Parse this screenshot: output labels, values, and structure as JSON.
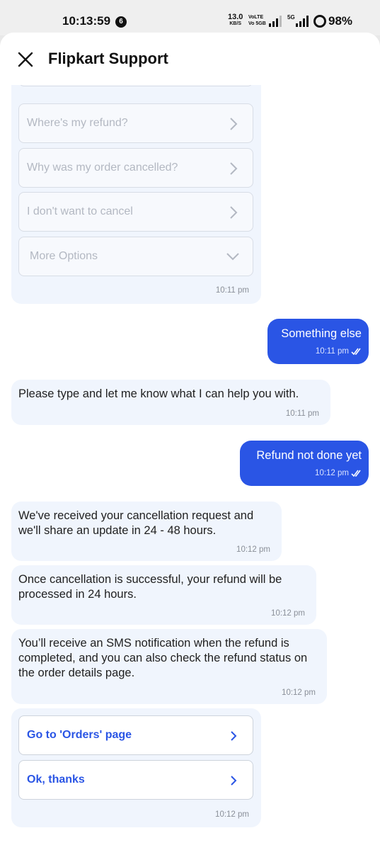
{
  "status_bar": {
    "time": "10:13:59",
    "notification_count": "6",
    "net_speed": "13.0",
    "net_speed_unit": "KB/S",
    "volte_1": "VoLTE",
    "volte_2": "Vo 5GB",
    "network_5g": "5G",
    "battery_pct": "98%"
  },
  "header": {
    "title": "Flipkart Support",
    "close_icon": "close-icon"
  },
  "colors": {
    "accent": "#2a55e5",
    "bot_bubble": "#f0f5fd",
    "muted_text": "#b3b8c2"
  },
  "chat": {
    "options_card": {
      "options": [
        "Where's my refund?",
        "Why was my order cancelled?",
        "I don't want to cancel"
      ],
      "more_label": "More Options",
      "time": "10:11 pm"
    },
    "messages": [
      {
        "from": "user",
        "text": "Something else",
        "time": "10:11 pm"
      },
      {
        "from": "bot",
        "text": "Please type and let me know what I can help you with.",
        "time": "10:11 pm"
      },
      {
        "from": "user",
        "text": "Refund not done yet",
        "time": "10:12 pm"
      },
      {
        "from": "bot",
        "text": "We've received your cancellation request and we'll share an update in 24 - 48 hours.",
        "time": "10:12 pm"
      },
      {
        "from": "bot",
        "text": "Once cancellation is successful, your refund will be processed in 24 hours.",
        "time": "10:12 pm"
      },
      {
        "from": "bot",
        "text": "You’ll receive an SMS notification when the refund is completed, and you can also check the refund status on the order details page.",
        "time": "10:12 pm"
      }
    ],
    "action_card": {
      "actions": [
        "Go to 'Orders' page",
        "Ok, thanks"
      ],
      "time": "10:12 pm"
    }
  }
}
